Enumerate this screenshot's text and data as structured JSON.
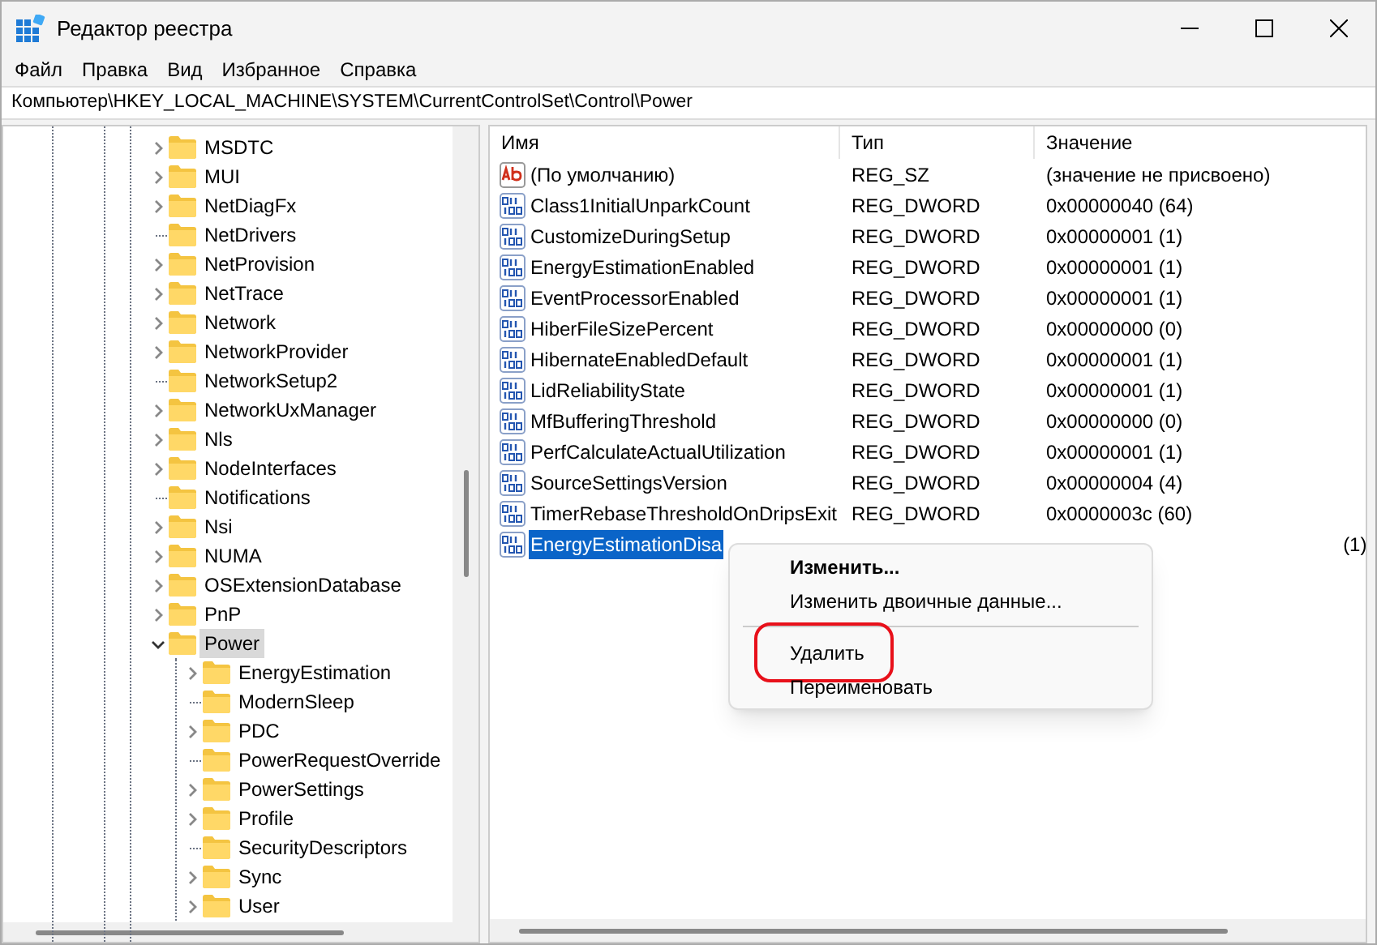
{
  "window": {
    "title": "Редактор реестра"
  },
  "menu": [
    "Файл",
    "Правка",
    "Вид",
    "Избранное",
    "Справка"
  ],
  "address": "Компьютер\\HKEY_LOCAL_MACHINE\\SYSTEM\\CurrentControlSet\\Control\\Power",
  "tree": [
    {
      "name": "MSDTC",
      "expanded": false,
      "selected": false
    },
    {
      "name": "MUI",
      "expanded": false,
      "selected": false
    },
    {
      "name": "NetDiagFx",
      "expanded": false,
      "selected": false
    },
    {
      "name": "NetDrivers",
      "selected": false
    },
    {
      "name": "NetProvision",
      "expanded": false,
      "selected": false
    },
    {
      "name": "NetTrace",
      "expanded": false,
      "selected": false
    },
    {
      "name": "Network",
      "expanded": false,
      "selected": false
    },
    {
      "name": "NetworkProvider",
      "expanded": false,
      "selected": false
    },
    {
      "name": "NetworkSetup2",
      "selected": false
    },
    {
      "name": "NetworkUxManager",
      "expanded": false,
      "selected": false
    },
    {
      "name": "Nls",
      "expanded": false,
      "selected": false
    },
    {
      "name": "NodeInterfaces",
      "expanded": false,
      "selected": false
    },
    {
      "name": "Notifications",
      "selected": false
    },
    {
      "name": "Nsi",
      "expanded": false,
      "selected": false
    },
    {
      "name": "NUMA",
      "expanded": false,
      "selected": false
    },
    {
      "name": "OSExtensionDatabase",
      "expanded": false,
      "selected": false
    },
    {
      "name": "PnP",
      "expanded": false,
      "selected": false
    },
    {
      "name": "Power",
      "expanded": true,
      "selected": true,
      "children": [
        {
          "name": "EnergyEstimation",
          "expanded": false,
          "selected": false
        },
        {
          "name": "ModernSleep",
          "selected": false
        },
        {
          "name": "PDC",
          "expanded": false,
          "selected": false
        },
        {
          "name": "PowerRequestOverride",
          "selected": false
        },
        {
          "name": "PowerSettings",
          "expanded": false,
          "selected": false
        },
        {
          "name": "Profile",
          "expanded": false,
          "selected": false
        },
        {
          "name": "SecurityDescriptors",
          "selected": false
        },
        {
          "name": "Sync",
          "expanded": false,
          "selected": false
        },
        {
          "name": "User",
          "expanded": false,
          "selected": false
        }
      ]
    }
  ],
  "table": {
    "columns": [
      "Имя",
      "Тип",
      "Значение"
    ],
    "rows": [
      {
        "kind": "string",
        "name": "(По умолчанию)",
        "type": "REG_SZ",
        "value": "(значение не присвоено)",
        "selected": false
      },
      {
        "kind": "dword",
        "name": "Class1InitialUnparkCount",
        "type": "REG_DWORD",
        "value": "0x00000040 (64)",
        "selected": false
      },
      {
        "kind": "dword",
        "name": "CustomizeDuringSetup",
        "type": "REG_DWORD",
        "value": "0x00000001 (1)",
        "selected": false
      },
      {
        "kind": "dword",
        "name": "EnergyEstimationEnabled",
        "type": "REG_DWORD",
        "value": "0x00000001 (1)",
        "selected": false
      },
      {
        "kind": "dword",
        "name": "EventProcessorEnabled",
        "type": "REG_DWORD",
        "value": "0x00000001 (1)",
        "selected": false
      },
      {
        "kind": "dword",
        "name": "HiberFileSizePercent",
        "type": "REG_DWORD",
        "value": "0x00000000 (0)",
        "selected": false
      },
      {
        "kind": "dword",
        "name": "HibernateEnabledDefault",
        "type": "REG_DWORD",
        "value": "0x00000001 (1)",
        "selected": false
      },
      {
        "kind": "dword",
        "name": "LidReliabilityState",
        "type": "REG_DWORD",
        "value": "0x00000001 (1)",
        "selected": false
      },
      {
        "kind": "dword",
        "name": "MfBufferingThreshold",
        "type": "REG_DWORD",
        "value": "0x00000000 (0)",
        "selected": false
      },
      {
        "kind": "dword",
        "name": "PerfCalculateActualUtilization",
        "type": "REG_DWORD",
        "value": "0x00000001 (1)",
        "selected": false
      },
      {
        "kind": "dword",
        "name": "SourceSettingsVersion",
        "type": "REG_DWORD",
        "value": "0x00000004 (4)",
        "selected": false
      },
      {
        "kind": "dword",
        "name": "TimerRebaseThresholdOnDripsExit",
        "type": "REG_DWORD",
        "value": "0x0000003c (60)",
        "selected": false
      },
      {
        "kind": "dword",
        "name": "EnergyEstimationDisa",
        "value_tail": "(1)",
        "selected": true
      }
    ]
  },
  "context_menu": [
    {
      "label": "Изменить...",
      "kind": "item",
      "bold": true,
      "highlighted": false
    },
    {
      "label": "Изменить двоичные данные...",
      "kind": "item",
      "bold": false,
      "highlighted": false
    },
    {
      "kind": "separator"
    },
    {
      "label": "Удалить",
      "kind": "item",
      "bold": false,
      "highlighted": true
    },
    {
      "label": "Переименовать",
      "kind": "item",
      "bold": false,
      "highlighted": false
    }
  ]
}
